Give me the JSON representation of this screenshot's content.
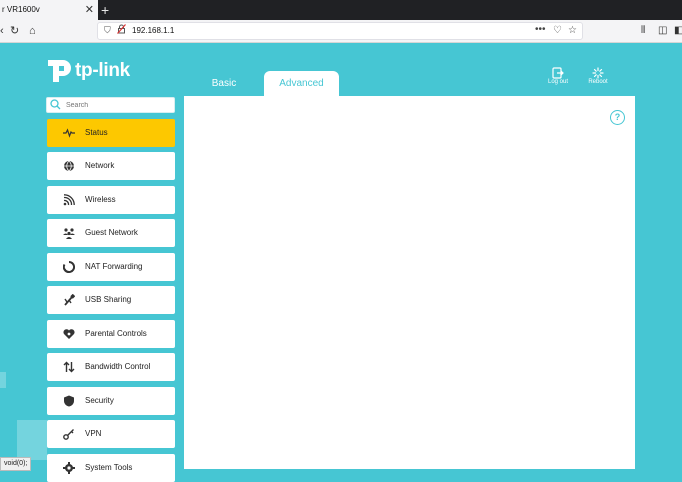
{
  "browser": {
    "tab_title": "r VR1600v",
    "close_glyph": "✕",
    "new_tab_glyph": "+",
    "url": "192.168.1.1",
    "url_actions": "•••"
  },
  "header": {
    "logo_text": "tp-link",
    "tabs": [
      {
        "label": "Basic"
      },
      {
        "label": "Advanced",
        "active": true
      }
    ],
    "logout_label": "Log out",
    "reboot_label": "Reboot"
  },
  "search": {
    "placeholder": "Search"
  },
  "sidebar": {
    "items": [
      {
        "label": "Status",
        "icon": "status-icon",
        "active": true
      },
      {
        "label": "Network",
        "icon": "globe-icon"
      },
      {
        "label": "Wireless",
        "icon": "wifi-icon"
      },
      {
        "label": "Guest Network",
        "icon": "guest-icon"
      },
      {
        "label": "NAT Forwarding",
        "icon": "nat-icon"
      },
      {
        "label": "USB Sharing",
        "icon": "usb-icon"
      },
      {
        "label": "Parental Controls",
        "icon": "heart-icon"
      },
      {
        "label": "Bandwidth Control",
        "icon": "bandwidth-icon"
      },
      {
        "label": "Security",
        "icon": "shield-icon"
      },
      {
        "label": "VPN",
        "icon": "key-icon"
      },
      {
        "label": "System Tools",
        "icon": "gear-icon"
      }
    ]
  },
  "help_glyph": "?",
  "status_text": "void(0);",
  "colors": {
    "accent": "#46c6d3",
    "active": "#fdc800"
  }
}
